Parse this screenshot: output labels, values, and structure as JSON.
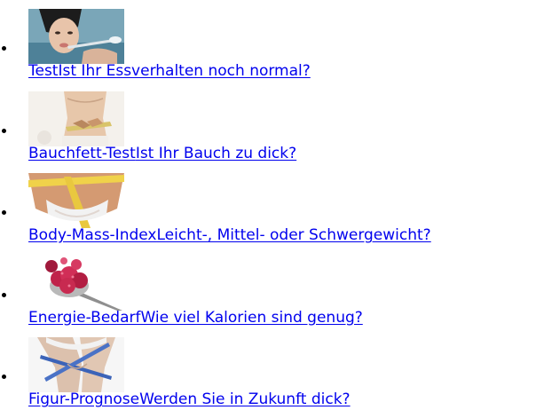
{
  "teasers": [
    {
      "image": "woman-eating-photo",
      "link_parts": [
        "Test",
        "Ist Ihr Essverhalten noch normal?"
      ]
    },
    {
      "image": "measuring-waist-photo",
      "link_parts": [
        "Bauchfett-Test",
        "Ist Ihr Bauch zu dick?"
      ]
    },
    {
      "image": "tape-measure-hips-photo",
      "link_parts": [
        "Body-Mass-Index",
        "Leicht-, Mittel- oder Schwergewicht?"
      ]
    },
    {
      "image": "raspberry-spoon-photo",
      "link_parts": [
        "Energie-Bedarf",
        "Wie viel Kalorien sind genug?"
      ]
    },
    {
      "image": "tape-measure-legs-photo",
      "link_parts": [
        "Figur-Prognose",
        "Werden Sie in Zukunft dick?"
      ]
    }
  ],
  "colors": {
    "link": "#0000ee",
    "bullet": "#000000",
    "background": "#ffffff"
  }
}
